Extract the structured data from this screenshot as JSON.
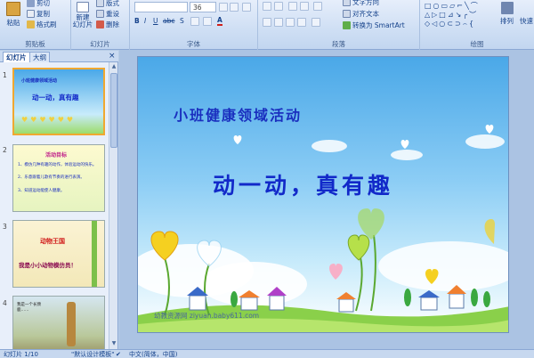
{
  "ribbon": {
    "clipboard": {
      "paste": "粘贴",
      "cut": "剪切",
      "copy": "复制",
      "format_painter": "格式刷",
      "label": "剪贴板"
    },
    "slides": {
      "new_slide": "新建\n幻灯片",
      "layout": "版式",
      "reset": "重设",
      "delete": "删除",
      "label": "幻灯片"
    },
    "font": {
      "size": "36",
      "label": "字体"
    },
    "paragraph": {
      "text_direction": "文字方向",
      "align_text": "对齐文本",
      "convert_smartart": "转换为 SmartArt",
      "label": "段落"
    },
    "drawing": {
      "arrange": "排列",
      "quick_styles": "快速",
      "label": "绘图"
    }
  },
  "panel": {
    "tab_slides": "幻灯片",
    "tab_outline": "大纲",
    "close": "×"
  },
  "thumbnails": [
    {
      "num": "1",
      "title": "小班健康领域活动",
      "main": "动一动，真有趣"
    },
    {
      "num": "2",
      "title": "活动目标",
      "line1": "1、模仿几种有趣的动作，体验运动的快乐。",
      "line2": "2、乐意跟着儿歌有节奏的进行表演。",
      "line3": "3、知道运动能使人健康。"
    },
    {
      "num": "3",
      "title": "动物王国",
      "text": "我是小小动物模仿员！"
    },
    {
      "num": "4",
      "text": "我是一个长颈鹿……"
    }
  ],
  "slide": {
    "title": "小班健康领域活动",
    "main": "动一动，真有趣",
    "watermark": "幼教资源网 ziyuan.baby611.com"
  },
  "status": {
    "slide_count": "幻灯片 1/10",
    "theme": "\"默认设计模板\"",
    "language": "中文(简体，中国)"
  },
  "colors": {
    "title": "#1a2fbf",
    "main": "#1229c9",
    "sky_top": "#4aa8e8",
    "grass": "#8ad04a"
  }
}
